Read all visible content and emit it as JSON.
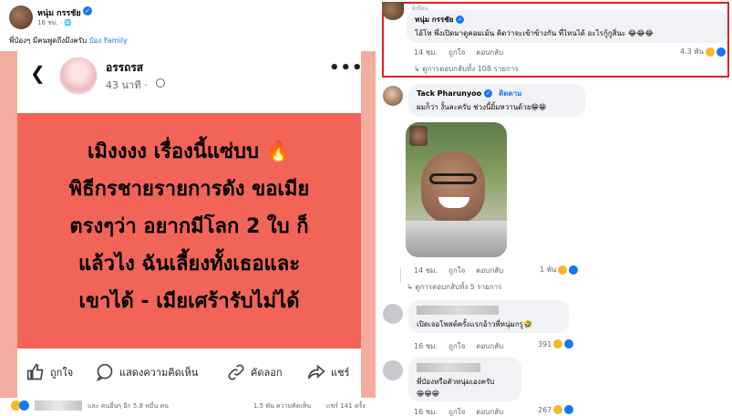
{
  "post": {
    "author": "หนุ่ม กรรชัย",
    "time": "16 ชม. · ",
    "caption": "พี่ป๋องๆ มีคนพูดถึงมึงครับ ",
    "caption_tag": "ป๋อง Family"
  },
  "shared": {
    "page_name": "อรรถรส",
    "time": "43 นาที · ",
    "headline_lines": [
      "เมิงงงง เรื่องนี้แซ่บบ 🔥",
      "พิธีกรชายรายการดัง ขอเมีย",
      "ตรงๆว่า อยากมีโลก 2 ใบ ก็",
      "แล้วไง ฉันเลี้ยงทั้งเธอและ",
      "เขาได้ - เมียเศร้ารับไม่ได้"
    ],
    "actions": {
      "like": "ถูกใจ",
      "comment": "แสดงความคิดเห็น",
      "copy": "คัดลอก",
      "share": "แชร์"
    }
  },
  "stats": {
    "reactions_others": "และ คนอื่นๆ อีก 5.8 หมื่น คน",
    "comments": "1.5 พัน ความคิดเห็น",
    "shares": "แชร์ 141 ครั้ง"
  },
  "comments": [
    {
      "gray_label": "ผู้เขียน",
      "author": "หนุ่ม กรรชัย",
      "text": "โอ้โห พึ่งเปิดมาดูคอมเม้น คิดว่าจะเข้าข้างกัน ที่ไหนได้ อะไรกู้กูสิ่นะ 😂😂😂",
      "time": "14 ชม.",
      "like": "ถูกใจ",
      "reply": "ตอบกลับ",
      "reaction_count": "4.3 พัน",
      "replies": "ดูการตอบกลับทั้ง 108 รายการ"
    },
    {
      "author": "Tack Pharunyoo",
      "follow": "ติดตาม",
      "text": "ผมก็ว่า งั้นละครับ ช่วงนี้ยิ้มหวานด้วย😁😁",
      "time": "14 ชม.",
      "like": "ถูกใจ",
      "reply": "ตอบกลับ",
      "reaction_count": "1 พัน",
      "replies": "ดูการตอบกลับทั้ง 5 รายการ"
    },
    {
      "text": "เปิดเจอโพสต์ครั้งแรกอ้าวพี่หนุ่มกรู🤣",
      "time": "16 ชม.",
      "like": "ถูกใจ",
      "reply": "ตอบกลับ",
      "reaction_count": "391"
    },
    {
      "text": "พี่ป๋องหรือตัวหนุ่มเองครับ",
      "text2": "😁😁😁",
      "time": "16 ชม.",
      "like": "ถูกใจ",
      "reply": "ตอบกลับ",
      "reaction_count": "267"
    }
  ],
  "colors": {
    "accent": "#1877f2",
    "highlight_border": "#e02020",
    "card_red": "#f26457",
    "card_border": "#f3ad9e"
  }
}
